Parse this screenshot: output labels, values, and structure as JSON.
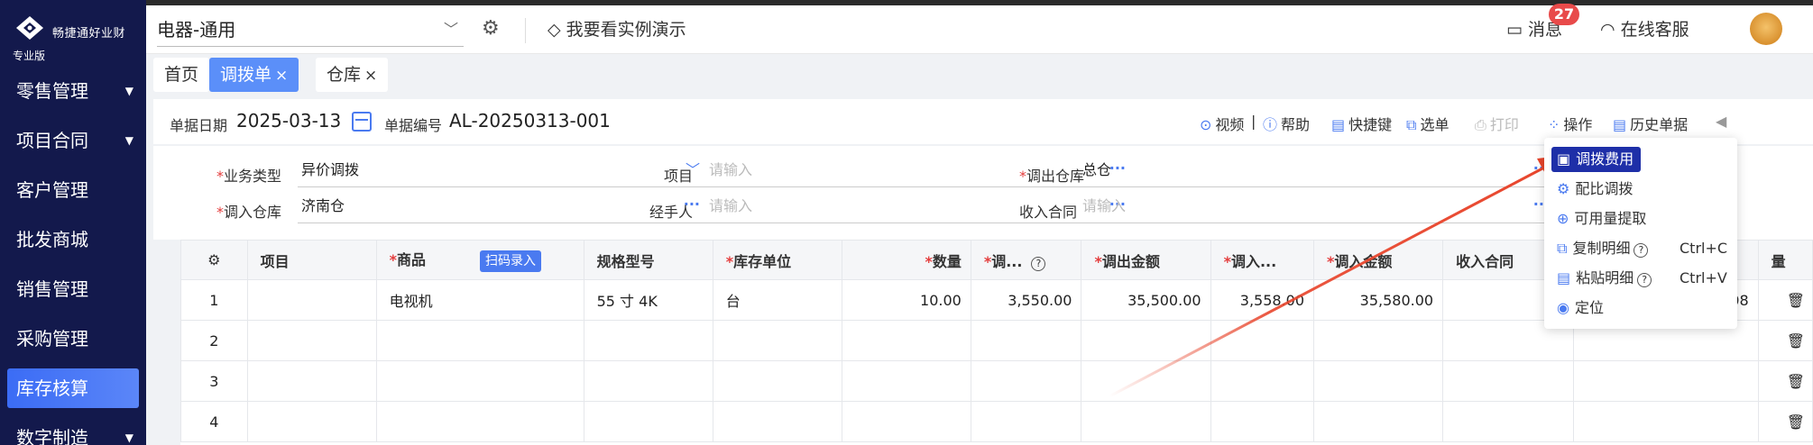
{
  "sidebar": {
    "brand": "畅捷通好业财",
    "edition": "专业版",
    "items": [
      {
        "label": "零售管理",
        "caret": true
      },
      {
        "label": "项目合同",
        "caret": true
      },
      {
        "label": "客户管理",
        "caret": false
      },
      {
        "label": "批发商城",
        "caret": false
      },
      {
        "label": "销售管理",
        "caret": false
      },
      {
        "label": "采购管理",
        "caret": false
      },
      {
        "label": "库存核算",
        "caret": false,
        "active": true
      },
      {
        "label": "数字制造",
        "caret": true
      }
    ]
  },
  "header": {
    "account_set": "电器-通用",
    "demo_link": "我要看实例演示",
    "messages_label": "消息",
    "messages_count": "27",
    "support_label": "在线客服"
  },
  "tabs": [
    {
      "label": "首页",
      "closable": false
    },
    {
      "label": "调拨单",
      "closable": true,
      "active": true
    },
    {
      "label": "仓库",
      "closable": true
    }
  ],
  "toolbar": {
    "date_label": "单据日期",
    "date_value": "2025-03-13",
    "number_label": "单据编号",
    "number_value": "AL-20250313-001",
    "video": "视频",
    "help": "帮助",
    "shortcut": "快捷键",
    "select": "选单",
    "print": "打印",
    "operate": "操作",
    "history": "历史单据"
  },
  "form": {
    "biz_type_label": "业务类型",
    "biz_type_value": "异价调拨",
    "project_label": "项目",
    "project_placeholder": "请输入",
    "out_wh_label": "调出仓库",
    "out_wh_value": "总仓",
    "in_wh_label": "调入仓库",
    "in_wh_value": "济南仓",
    "handler_label": "经手人",
    "handler_placeholder": "请输入",
    "income_contract_label": "收入合同",
    "income_contract_placeholder": "请输入"
  },
  "grid": {
    "columns": [
      "",
      "项目",
      "商品",
      "规格型号",
      "库存单位",
      "数量",
      "调...",
      "调出金额",
      "调入...",
      "调入金额",
      "收入合同",
      "",
      "量"
    ],
    "scan_button": "扫码录入",
    "rows": [
      {
        "idx": "1",
        "project": "",
        "product": "电视机",
        "spec": "55 寸 4K",
        "unit": "台",
        "qty": "10.00",
        "out_price": "3,550.00",
        "out_amount": "35,500.00",
        "in_price": "3,558.00",
        "in_amount": "35,580.00",
        "contract": "",
        "tail": "908"
      },
      {
        "idx": "2"
      },
      {
        "idx": "3"
      },
      {
        "idx": "4"
      }
    ]
  },
  "menu": {
    "items": [
      {
        "label": "调拨费用",
        "icon": "fee-icon",
        "active": true
      },
      {
        "label": "配比调拨",
        "icon": "ratio-icon"
      },
      {
        "label": "可用量提取",
        "icon": "extract-icon"
      },
      {
        "label": "复制明细",
        "icon": "copy-icon",
        "help": true,
        "shortcut": "Ctrl+C"
      },
      {
        "label": "粘贴明细",
        "icon": "paste-icon",
        "help": true,
        "shortcut": "Ctrl+V"
      },
      {
        "label": "定位",
        "icon": "locate-icon"
      }
    ]
  },
  "colors": {
    "sidebar_bg": "#13194c",
    "accent": "#4a7af0",
    "active_tab": "#5b8ff9",
    "menu_active": "#1e2fa8",
    "badge": "#e84a4a",
    "arrow": "#e8452c"
  }
}
